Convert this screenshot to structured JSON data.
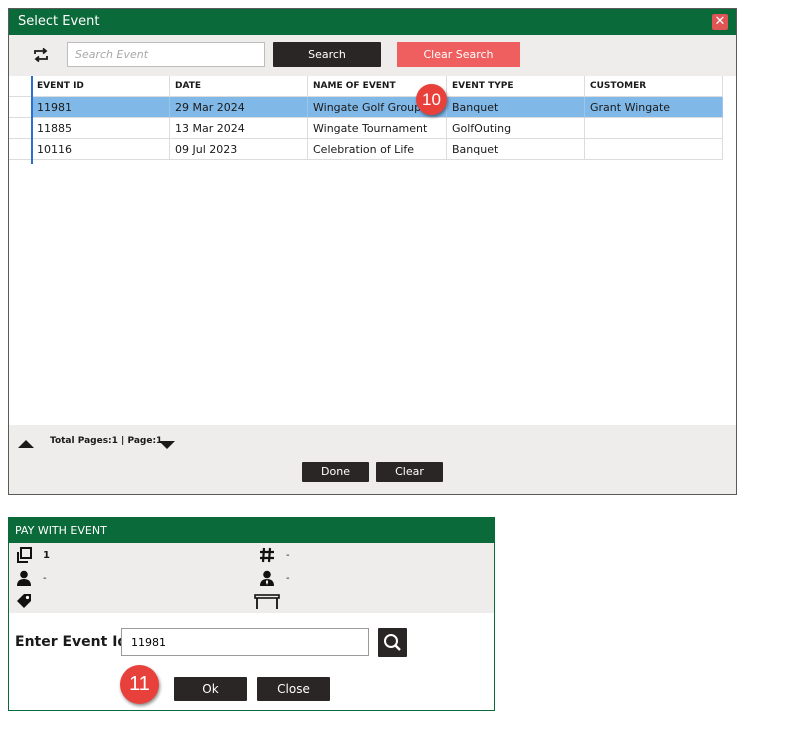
{
  "select_event": {
    "title": "Select Event",
    "close_glyph": "✕",
    "search_placeholder": "Search Event",
    "search_label": "Search",
    "clear_search_label": "Clear Search",
    "columns": [
      "EVENT ID",
      "DATE",
      "NAME OF EVENT",
      "EVENT TYPE",
      "CUSTOMER"
    ],
    "rows": [
      {
        "id": "11981",
        "date": "29 Mar 2024",
        "name": "Wingate Golf Group",
        "type": "Banquet",
        "customer": "Grant Wingate",
        "selected": true
      },
      {
        "id": "11885",
        "date": "13 Mar 2024",
        "name": "Wingate Tournament",
        "type": "GolfOuting",
        "customer": "",
        "selected": false
      },
      {
        "id": "10116",
        "date": "09 Jul 2023",
        "name": "Celebration of Life",
        "type": "Banquet",
        "customer": "",
        "selected": false
      }
    ],
    "page_info": "Total Pages:1  |  Page:1",
    "done_label": "Done",
    "clear_label": "Clear",
    "badge": "10"
  },
  "pay_with_event": {
    "title": "PAY WITH EVENT",
    "info": {
      "copies_value": "1",
      "hash_value": "-",
      "person_value": "-",
      "server_value": "-"
    },
    "enter_label": "Enter Event Id",
    "event_id_value": "11981",
    "ok_label": "Ok",
    "close_label": "Close",
    "badge": "11"
  },
  "colors": {
    "title_green": "#0a6a3a",
    "selected_row": "#80b8e8",
    "clear_search_red": "#ef5f5f",
    "badge_red": "#e8413c",
    "dark_button": "#2b2626"
  }
}
